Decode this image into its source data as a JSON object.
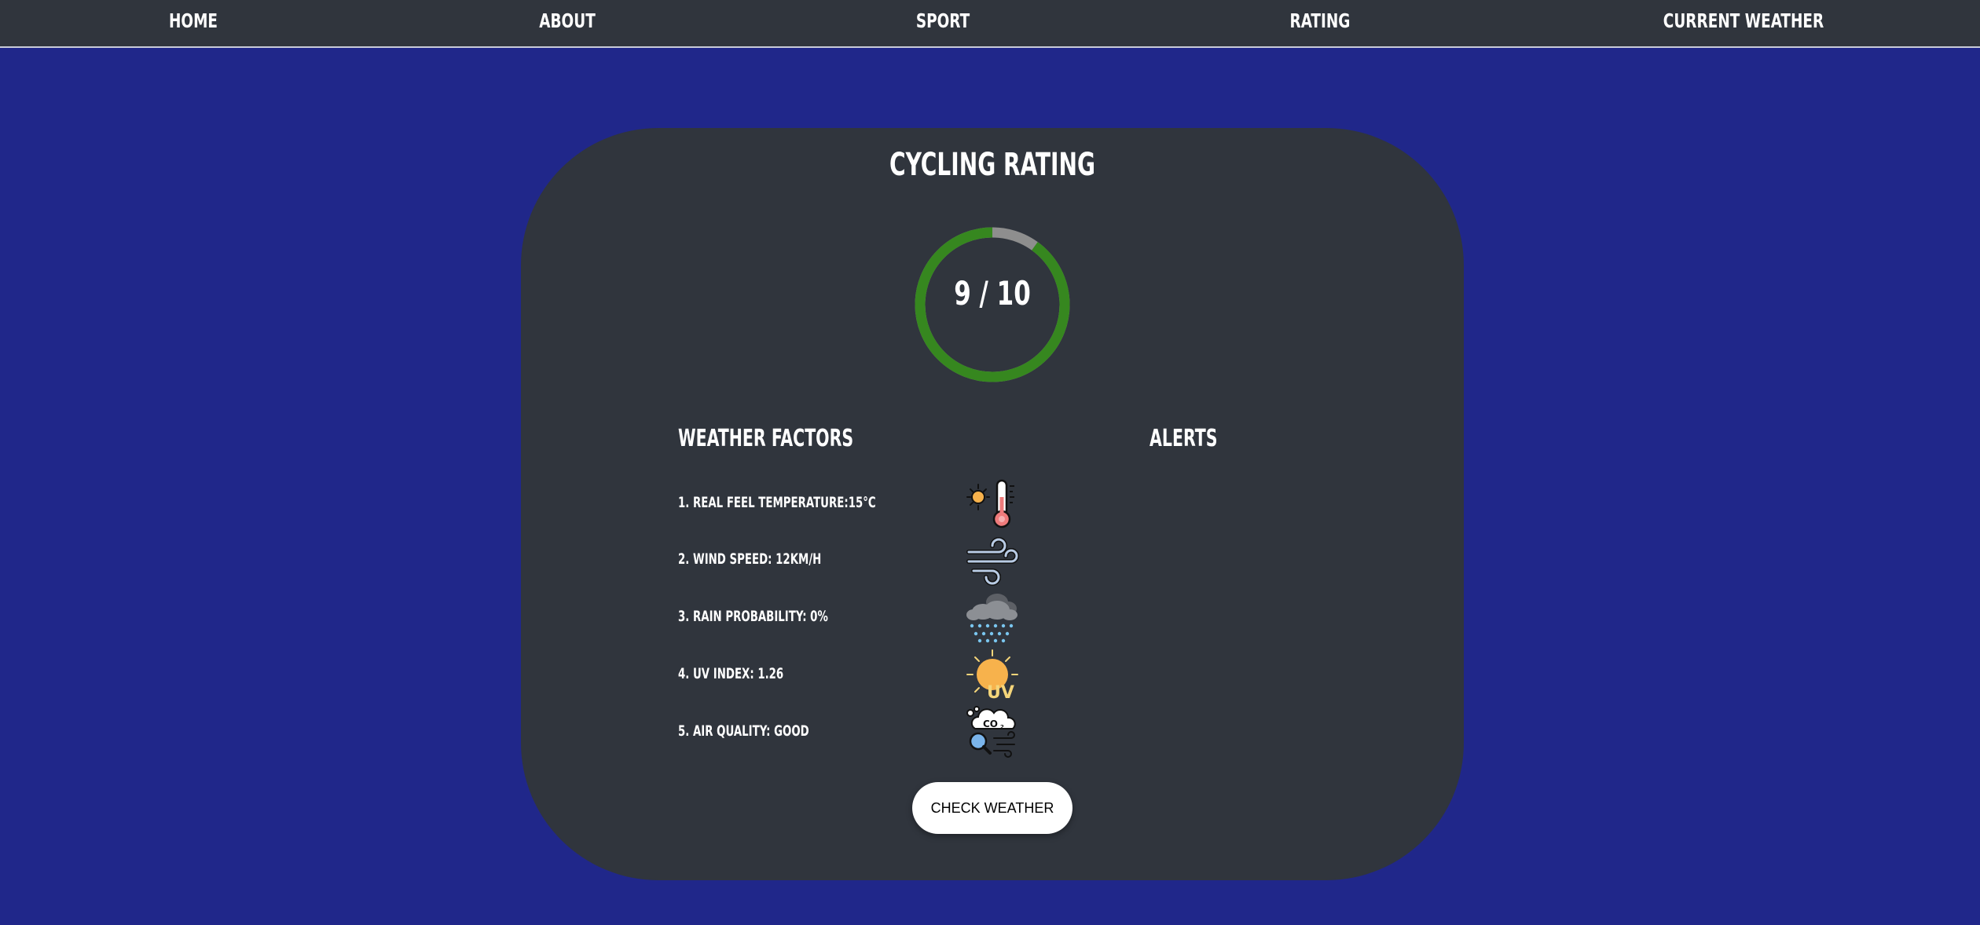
{
  "nav": {
    "items": [
      {
        "label": "HOME"
      },
      {
        "label": "ABOUT"
      },
      {
        "label": "SPORT"
      },
      {
        "label": "RATING"
      },
      {
        "label": "CURRENT WEATHER"
      }
    ]
  },
  "rating": {
    "title": "CYCLING RATING",
    "score_text": "9 / 10",
    "score": 9,
    "max": 10,
    "colors": {
      "progress": "#36871f",
      "track": "#8e8e8e"
    }
  },
  "weather_factors": {
    "heading": "WEATHER FACTORS",
    "items": [
      {
        "label": "1. REAL FEEL TEMPERATURE:15°C",
        "icon": "thermometer-sun-icon"
      },
      {
        "label": "2. WIND SPEED: 12KM/H",
        "icon": "wind-icon"
      },
      {
        "label": "3. RAIN PROBABILITY: 0%",
        "icon": "rain-cloud-icon"
      },
      {
        "label": "4. UV INDEX: 1.26",
        "icon": "uv-sun-icon"
      },
      {
        "label": "5. AIR QUALITY: GOOD",
        "icon": "co2-cloud-icon"
      }
    ]
  },
  "alerts": {
    "heading": "ALERTS"
  },
  "actions": {
    "check_weather_label": "CHECK WEATHER"
  },
  "colors": {
    "background": "#20278a",
    "navbar": "#30353d",
    "card": "#30353d"
  }
}
